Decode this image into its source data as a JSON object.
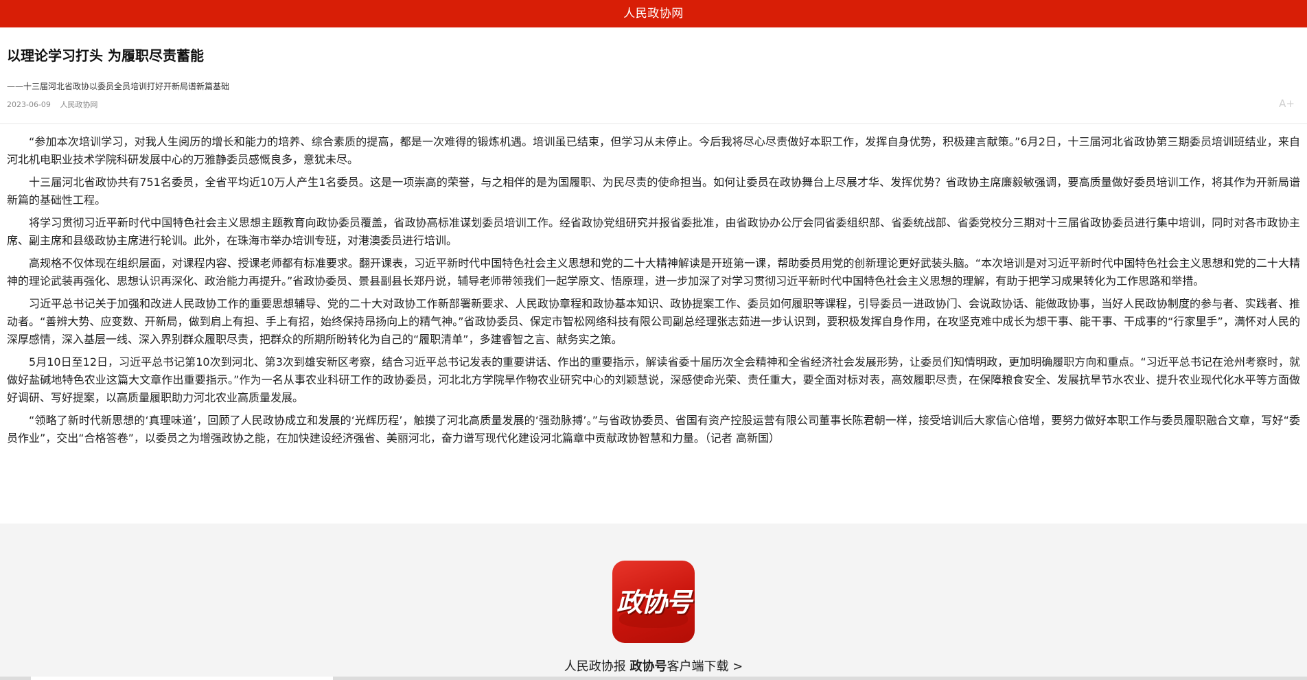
{
  "header": {
    "site_name": "人民政协网",
    "bar_color": "#d81e06"
  },
  "article": {
    "title": "以理论学习打头 为履职尽责蓄能",
    "subtitle": "——十三届河北省政协以委员全员培训打好开新局谱新篇基础",
    "date": "2023-06-09",
    "source": "人民政协网",
    "font_size_label": "A+",
    "paragraphs": [
      "“参加本次培训学习，对我人生阅历的增长和能力的培养、综合素质的提高，都是一次难得的锻炼机遇。培训虽已结束，但学习从未停止。今后我将尽心尽责做好本职工作，发挥自身优势，积极建言献策。”6月2日，十三届河北省政协第三期委员培训班结业，来自河北机电职业技术学院科研发展中心的万雅静委员感慨良多，意犹未尽。",
      "十三届河北省政协共有751名委员，全省平均近10万人产生1名委员。这是一项崇高的荣誉，与之相伴的是为国履职、为民尽责的使命担当。如何让委员在政协舞台上尽展才华、发挥优势？省政协主席廉毅敏强调，要高质量做好委员培训工作，将其作为开新局谱新篇的基础性工程。",
      "将学习贯彻习近平新时代中国特色社会主义思想主题教育向政协委员覆盖，省政协高标准谋划委员培训工作。经省政协党组研究并报省委批准，由省政协办公厅会同省委组织部、省委统战部、省委党校分三期对十三届省政协委员进行集中培训，同时对各市政协主席、副主席和县级政协主席进行轮训。此外，在珠海市举办培训专班，对港澳委员进行培训。",
      "高规格不仅体现在组织层面，对课程内容、授课老师都有标准要求。翻开课表，习近平新时代中国特色社会主义思想和党的二十大精神解读是开班第一课，帮助委员用党的创新理论更好武装头脑。“本次培训是对习近平新时代中国特色社会主义思想和党的二十大精神的理论武装再强化、思想认识再深化、政治能力再提升。”省政协委员、景县副县长郑丹说，辅导老师带领我们一起学原文、悟原理，进一步加深了对学习贯彻习近平新时代中国特色社会主义思想的理解，有助于把学习成果转化为工作思路和举措。",
      "习近平总书记关于加强和改进人民政协工作的重要思想辅导、党的二十大对政协工作新部署新要求、人民政协章程和政协基本知识、政协提案工作、委员如何履职等课程，引导委员一进政协门、会说政协话、能做政协事，当好人民政协制度的参与者、实践者、推动者。“善辨大势、应变数、开新局，做到肩上有担、手上有招，始终保持昂扬向上的精气神。”省政协委员、保定市智松网络科技有限公司副总经理张志茹进一步认识到，要积极发挥自身作用，在攻坚克难中成长为想干事、能干事、干成事的“行家里手”，满怀对人民的深厚感情，深入基层一线、深入界别群众履职尽责，把群众的所期所盼转化为自己的“履职清单”，多建睿智之言、献务实之策。",
      "5月10日至12日，习近平总书记第10次到河北、第3次到雄安新区考察，结合习近平总书记发表的重要讲话、作出的重要指示，解读省委十届历次全会精神和全省经济社会发展形势，让委员们知情明政，更加明确履职方向和重点。“习近平总书记在沧州考察时，就做好盐碱地特色农业这篇大文章作出重要指示。”作为一名从事农业科研工作的政协委员，河北北方学院旱作物农业研究中心的刘颖慧说，深感使命光荣、责任重大，要全面对标对表，高效履职尽责，在保障粮食安全、发展抗旱节水农业、提升农业现代化水平等方面做好调研、写好提案，以高质量履职助力河北农业高质量发展。",
      "“领略了新时代新思想的‘真理味道’，回顾了人民政协成立和发展的‘光辉历程’，触摸了河北高质量发展的‘强劲脉搏’。”与省政协委员、省国有资产控股运营有限公司董事长陈君朝一样，接受培训后大家信心倍增，要努力做好本职工作与委员履职融合文章，写好“委员作业”，交出“合格答卷”，以委员之为增强政协之能，在加快建设经济强省、美丽河北，奋力谱写现代化建设河北篇章中贡献政协智慧和力量。（记者 高新国）"
    ]
  },
  "footer": {
    "app_logo_text": "政协号",
    "download_prefix": "人民政协报 ",
    "download_brand": "政协号",
    "download_suffix": "客户端下载 >"
  }
}
